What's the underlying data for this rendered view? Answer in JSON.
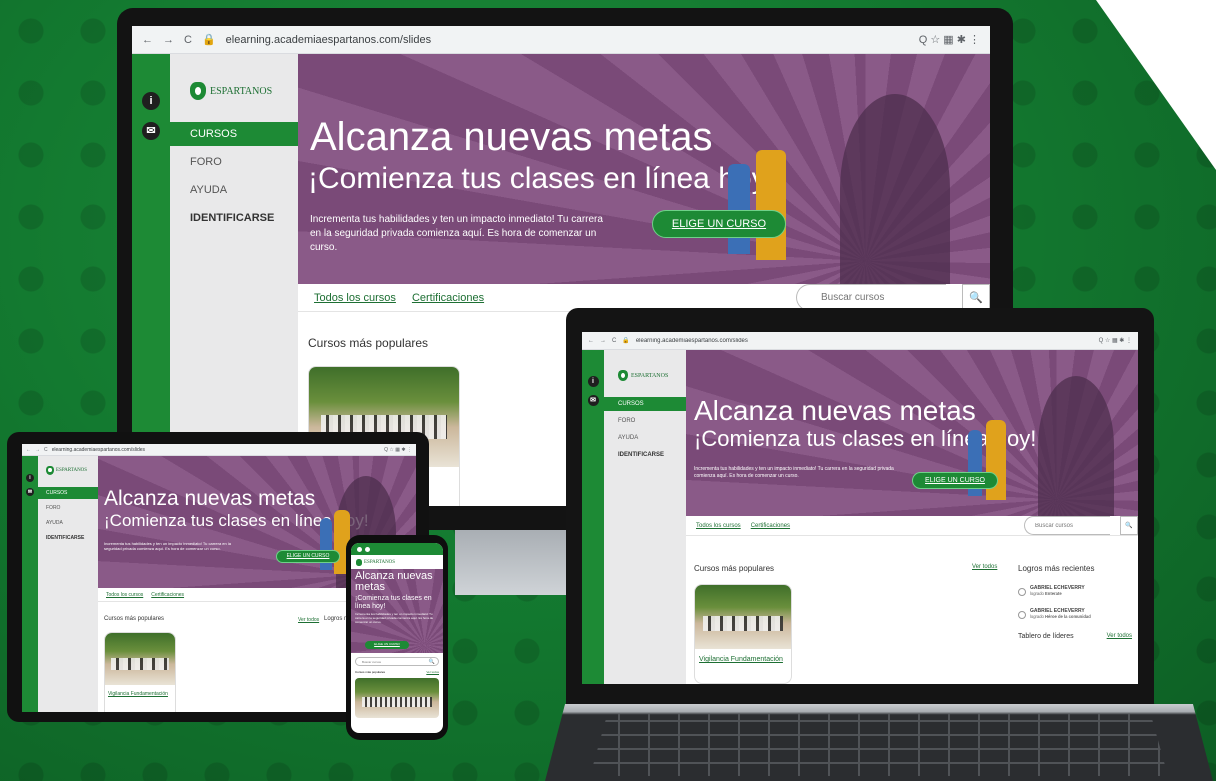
{
  "browser": {
    "url": "elearning.academiaespartanos.com/slides",
    "back_glyph": "←",
    "forward_glyph": "→",
    "reload_glyph": "C",
    "lock_glyph": "🔒",
    "actions_glyph": "Q ☆ ▦ ✱ ⋮"
  },
  "site": {
    "logo_text": "ESPARTANOS",
    "rail": {
      "info_glyph": "i",
      "mail_glyph": "✉"
    },
    "nav": [
      {
        "label": "CURSOS"
      },
      {
        "label": "FORO"
      },
      {
        "label": "AYUDA"
      },
      {
        "label": "IDENTIFICARSE"
      }
    ],
    "hero": {
      "title": "Alcanza nuevas metas",
      "subtitle": "¡Comienza tus clases en línea hoy!",
      "body": "Incrementa tus habilidades y ten un impacto inmediato! Tu carrera en la seguridad privada comienza aquí. Es hora de comenzar un curso.",
      "cta": "ELIGE UN CURSO"
    },
    "toolbar": {
      "all_courses": "Todos los cursos",
      "certifications": "Certificaciones",
      "search_placeholder": "Buscar cursos",
      "search_glyph": "🔍"
    },
    "popular_title": "Cursos más populares",
    "see_all": "Ver todos",
    "course": {
      "title": "Vigilancia Fundamentación"
    },
    "achievements": {
      "title": "Logros más recientes",
      "items": [
        {
          "name": "GABRIEL ECHEVERRY",
          "label": "logrado",
          "badge": "Enterate"
        },
        {
          "name": "GABRIEL ECHEVERRY",
          "label": "logrado",
          "badge": "Héroe de la comunidad"
        }
      ],
      "leaderboard": "Tablero de líderes",
      "leaderboard_link": "Ver todos"
    }
  },
  "colors": {
    "brand_green": "#1d8a35",
    "hero_purple": "#7a4a78",
    "background_green": "#137a30"
  }
}
